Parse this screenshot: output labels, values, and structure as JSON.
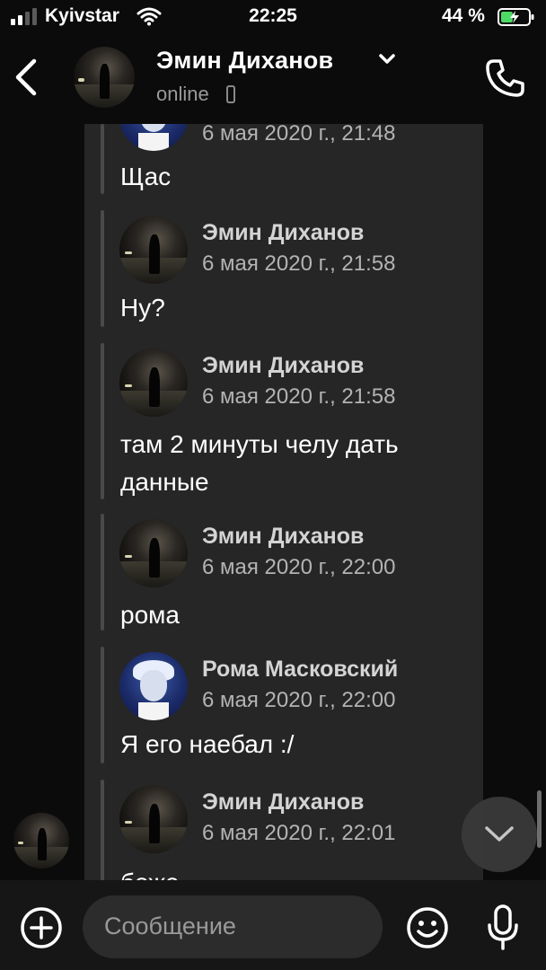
{
  "status_bar": {
    "carrier": "Kyivstar",
    "time": "22:25",
    "battery": "44 %",
    "battery_level": 0.44
  },
  "header": {
    "name": "Эмин Диханов",
    "status": "online"
  },
  "messages": [
    {
      "author": "",
      "date": "6 мая 2020 г., 21:48",
      "text": "Щас",
      "avatar": "anime-avatar"
    },
    {
      "author": "Эмин Диханов",
      "date": "6 мая 2020 г., 21:58",
      "text": "Ну?",
      "avatar": "photo-avatar"
    },
    {
      "author": "Эмин Диханов",
      "date": "6 мая 2020 г., 21:58",
      "text": "там 2 минуты челу дать данные",
      "avatar": "photo-avatar"
    },
    {
      "author": "Эмин Диханов",
      "date": "6 мая 2020 г., 22:00",
      "text": "рома",
      "avatar": "photo-avatar"
    },
    {
      "author": "Рома Масковский",
      "date": "6 мая 2020 г., 22:00",
      "text": "Я его наебал :/",
      "avatar": "anime-avatar"
    },
    {
      "author": "Эмин Диханов",
      "date": "6 мая 2020 г., 22:01",
      "text": "боже",
      "avatar": "photo-avatar"
    }
  ],
  "input": {
    "placeholder": "Сообщение"
  },
  "icons": {
    "back": "chevron-left-icon",
    "call": "phone-icon",
    "scroll": "chevron-down-icon",
    "attach": "plus-circle-icon",
    "emoji": "smile-icon",
    "voice": "microphone-icon"
  },
  "colors": {
    "background": "#0b0b0b",
    "bubble": "#262626",
    "battery_fill": "#4cd964"
  }
}
